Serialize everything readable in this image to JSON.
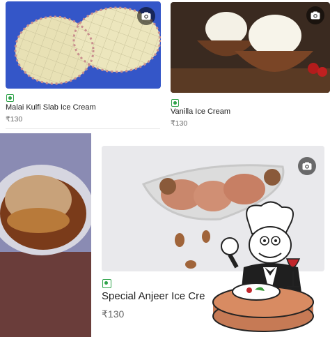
{
  "items": [
    {
      "name": "Malai Kulfi Slab Ice Cream",
      "price": "₹130",
      "veg_icon": "veg-indicator-icon",
      "photo_icon": "camera-icon"
    },
    {
      "name": "Vanilla Ice Cream",
      "price": "₹130",
      "veg_icon": "veg-indicator-icon",
      "photo_icon": "camera-icon"
    },
    {
      "name": "Special Anjeer Ice Cre",
      "price": "₹130",
      "veg_icon": "veg-indicator-icon",
      "photo_icon": "camera-icon"
    }
  ],
  "colors": {
    "veg": "#2fa34a",
    "text": "#1c1c1c",
    "price": "#696969",
    "kulfi_bg": "#3a5fd0"
  },
  "overlay": {
    "icon": "chef-dining-sticker-icon"
  }
}
